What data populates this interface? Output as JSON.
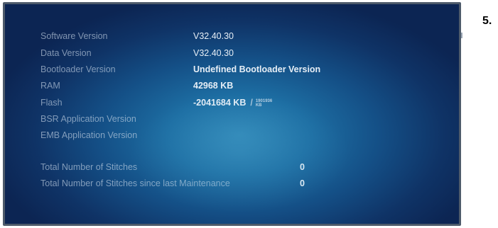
{
  "info_panel": {
    "rows": [
      {
        "label": "Software Version",
        "value": "V32.40.30"
      },
      {
        "label": "Data Version",
        "value": "V32.40.30"
      },
      {
        "label": "Bootloader Version",
        "value": "Undefined Bootloader Version"
      },
      {
        "label": "RAM",
        "value": "42968 KB"
      },
      {
        "label": "Flash",
        "value": "-2041684 KB",
        "separator": "/",
        "fraction_top": "1901936",
        "fraction_bottom": "KB"
      },
      {
        "label": "BSR Application Version",
        "value": ""
      },
      {
        "label": "EMB Application Version",
        "value": ""
      }
    ],
    "stitches": [
      {
        "label": "Total Number of Stitches",
        "value": "0"
      },
      {
        "label": "Total Number of Stitches since last Maintenance",
        "value": "0"
      }
    ]
  },
  "step_label": "5."
}
